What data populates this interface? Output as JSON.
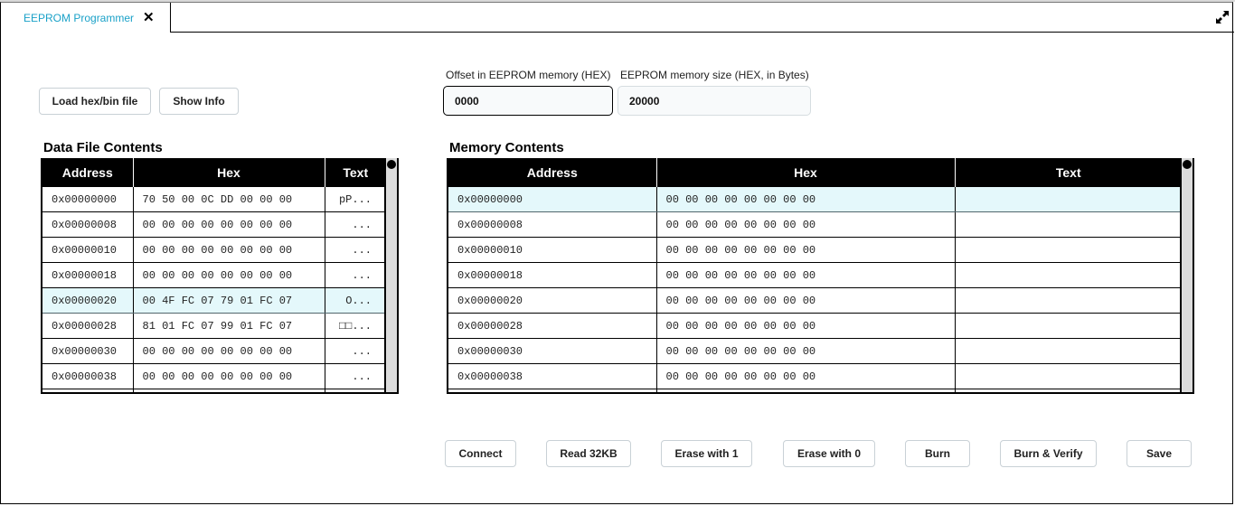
{
  "app": {
    "tab_title": "EEPROM Programmer",
    "tab_close_icon": "close-icon",
    "expand_icon": "expand-icon"
  },
  "toolbar": {
    "load_label": "Load hex/bin file",
    "info_label": "Show Info"
  },
  "fields": {
    "offset_label": "Offset in EEPROM memory (HEX)",
    "offset_value": "0000",
    "size_label": "EEPROM memory size (HEX, in Bytes)",
    "size_value": "20000"
  },
  "data_file": {
    "title": "Data File Contents",
    "columns": [
      "Address",
      "Hex",
      "Text"
    ],
    "selected_index": 4,
    "rows": [
      {
        "address": "0x00000000",
        "hex": "70 50 00 0C DD 00 00 00",
        "text": "pP..."
      },
      {
        "address": "0x00000008",
        "hex": "00 00 00 00 00 00 00 00",
        "text": "..."
      },
      {
        "address": "0x00000010",
        "hex": "00 00 00 00 00 00 00 00",
        "text": "..."
      },
      {
        "address": "0x00000018",
        "hex": "00 00 00 00 00 00 00 00",
        "text": "..."
      },
      {
        "address": "0x00000020",
        "hex": "00 4F FC 07 79 01 FC 07",
        "text": "O..."
      },
      {
        "address": "0x00000028",
        "hex": "81 01 FC 07 99 01 FC 07",
        "text": "□□..."
      },
      {
        "address": "0x00000030",
        "hex": "00 00 00 00 00 00 00 00",
        "text": "..."
      },
      {
        "address": "0x00000038",
        "hex": "00 00 00 00 00 00 00 00",
        "text": "..."
      }
    ]
  },
  "memory": {
    "title": "Memory Contents",
    "columns": [
      "Address",
      "Hex",
      "Text"
    ],
    "selected_index": 0,
    "rows": [
      {
        "address": "0x00000000",
        "hex": "00 00 00 00 00 00 00 00",
        "text": ""
      },
      {
        "address": "0x00000008",
        "hex": "00 00 00 00 00 00 00 00",
        "text": ""
      },
      {
        "address": "0x00000010",
        "hex": "00 00 00 00 00 00 00 00",
        "text": ""
      },
      {
        "address": "0x00000018",
        "hex": "00 00 00 00 00 00 00 00",
        "text": ""
      },
      {
        "address": "0x00000020",
        "hex": "00 00 00 00 00 00 00 00",
        "text": ""
      },
      {
        "address": "0x00000028",
        "hex": "00 00 00 00 00 00 00 00",
        "text": ""
      },
      {
        "address": "0x00000030",
        "hex": "00 00 00 00 00 00 00 00",
        "text": ""
      },
      {
        "address": "0x00000038",
        "hex": "00 00 00 00 00 00 00 00",
        "text": ""
      }
    ]
  },
  "actions": {
    "connect": "Connect",
    "read": "Read 32KB",
    "erase1": "Erase with 1",
    "erase0": "Erase with 0",
    "burn": "Burn",
    "burn_verify": "Burn & Verify",
    "save": "Save"
  },
  "colors": {
    "tab_accent": "#1aa1c8",
    "selected_row": "#e4f8fb",
    "header_bg": "#000000"
  }
}
